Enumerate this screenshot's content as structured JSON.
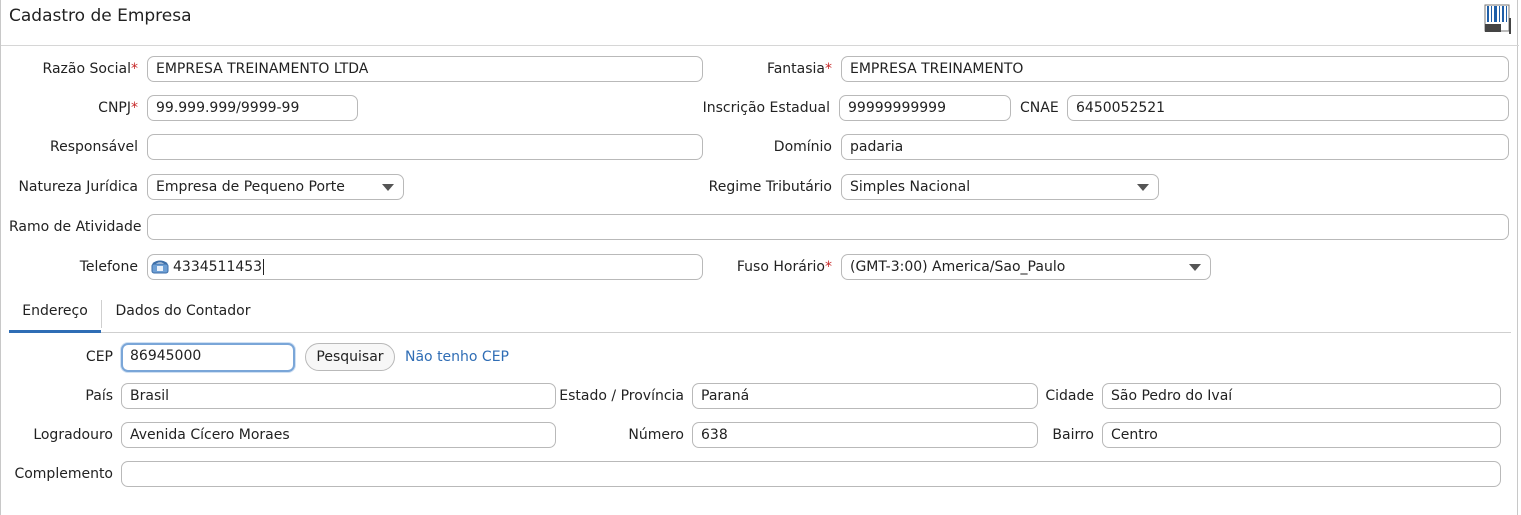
{
  "window": {
    "title": "Cadastro de Empresa"
  },
  "form": {
    "razao_social": {
      "label": "Razão Social",
      "req": "*",
      "value": "EMPRESA TREINAMENTO LTDA"
    },
    "fantasia": {
      "label": "Fantasia",
      "req": "*",
      "value": "EMPRESA TREINAMENTO"
    },
    "cnpj": {
      "label": "CNPJ",
      "req": "*",
      "value": "99.999.999/9999-99"
    },
    "inscricao_estadual": {
      "label": "Inscrição Estadual",
      "value": "99999999999"
    },
    "cnae": {
      "label": "CNAE",
      "value": "6450052521"
    },
    "responsavel": {
      "label": "Responsável",
      "value": ""
    },
    "dominio": {
      "label": "Domínio",
      "value": "padaria"
    },
    "natureza_juridica": {
      "label": "Natureza Jurídica",
      "value": "Empresa de Pequeno Porte"
    },
    "regime_tributario": {
      "label": "Regime Tributário",
      "value": "Simples Nacional"
    },
    "ramo_atividade": {
      "label": "Ramo de Atividade",
      "value": ""
    },
    "telefone": {
      "label": "Telefone",
      "value": "4334511453",
      "icon": "phone-icon"
    },
    "fuso_horario": {
      "label": "Fuso Horário",
      "req": "*",
      "value": "(GMT-3:00) America/Sao_Paulo"
    }
  },
  "tabs": [
    {
      "label": "Endereço",
      "active": true
    },
    {
      "label": "Dados do Contador",
      "active": false
    }
  ],
  "endereco": {
    "cep": {
      "label": "CEP",
      "value": "86945000"
    },
    "pesquisar_label": "Pesquisar",
    "sem_cep_label": "Não tenho CEP",
    "pais": {
      "label": "País",
      "value": "Brasil"
    },
    "estado": {
      "label": "Estado / Província",
      "value": "Paraná"
    },
    "cidade": {
      "label": "Cidade",
      "value": "São Pedro do Ivaí"
    },
    "logradouro": {
      "label": "Logradouro",
      "value": "Avenida Cícero Moraes"
    },
    "numero": {
      "label": "Número",
      "value": "638"
    },
    "bairro": {
      "label": "Bairro",
      "value": "Centro"
    },
    "complemento": {
      "label": "Complemento",
      "value": ""
    }
  },
  "colors": {
    "required": "#c62828",
    "accent": "#2f6db5",
    "focus": "#7aa6d8"
  }
}
